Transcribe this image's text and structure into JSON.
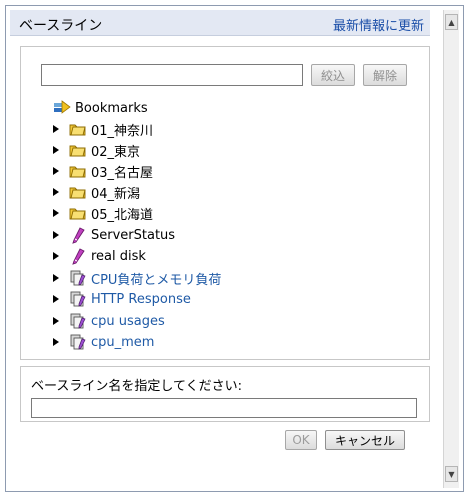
{
  "header": {
    "title": "ベースライン",
    "refresh_label": "最新情報に更新"
  },
  "search": {
    "value": "",
    "filter_label": "絞込",
    "clear_label": "解除"
  },
  "tree": {
    "root": {
      "label": "Bookmarks",
      "icon": "bookmarks-icon"
    },
    "items": [
      {
        "label": "01_神奈川",
        "icon": "folder-icon"
      },
      {
        "label": "02_東京",
        "icon": "folder-icon"
      },
      {
        "label": "03_名古屋",
        "icon": "folder-icon"
      },
      {
        "label": "04_新潟",
        "icon": "folder-icon"
      },
      {
        "label": "05_北海道",
        "icon": "folder-icon"
      },
      {
        "label": "ServerStatus",
        "icon": "bookmark-pen-icon"
      },
      {
        "label": "real disk",
        "icon": "bookmark-pen-icon"
      },
      {
        "label": "CPU負荷とメモリ負荷",
        "icon": "combined-bookmark-icon"
      },
      {
        "label": "HTTP Response",
        "icon": "combined-bookmark-icon"
      },
      {
        "label": "cpu usages",
        "icon": "combined-bookmark-icon"
      },
      {
        "label": "cpu_mem",
        "icon": "combined-bookmark-icon"
      }
    ]
  },
  "baseline_name": {
    "label": "ベースライン名を指定してください:",
    "value": ""
  },
  "footer": {
    "ok_label": "OK",
    "cancel_label": "キャンセル"
  },
  "colors": {
    "link": "#1f5aa6",
    "header_bg": "#e3e8f3",
    "folder": "#f0c020"
  }
}
